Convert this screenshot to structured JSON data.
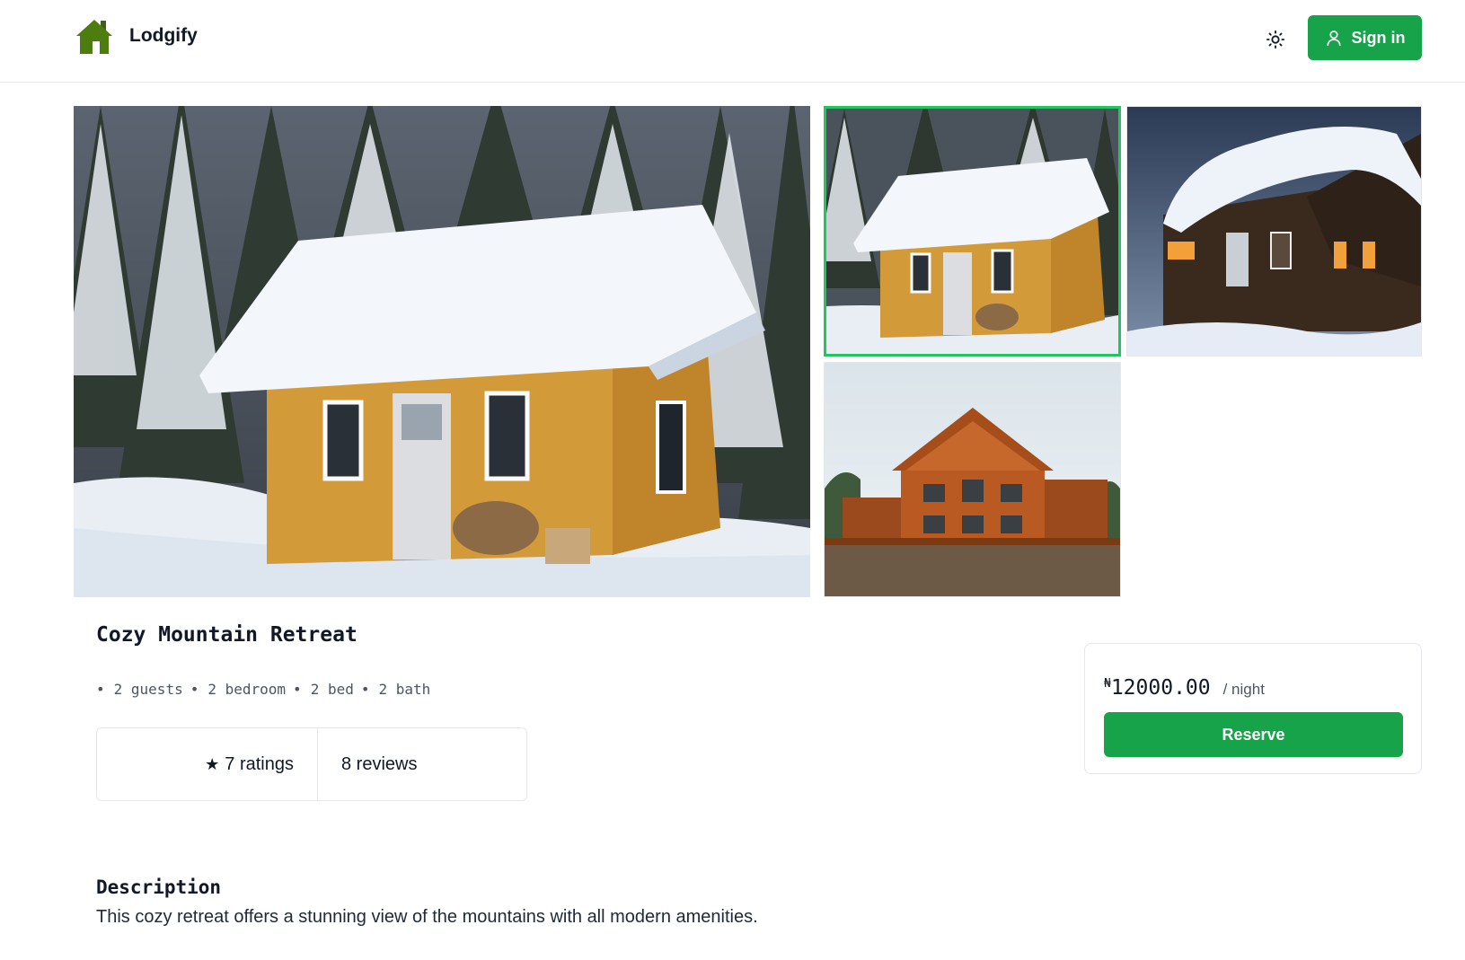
{
  "header": {
    "brand": "Lodgify",
    "signin_label": "Sign in",
    "brand_color": "#4d7c0f",
    "accent_color": "#16a34a"
  },
  "gallery": {
    "main_photo": "snow-cabin-photo",
    "thumbnails": [
      "snow-cabin-photo",
      "night-cabin-photo",
      "log-lodge-photo"
    ],
    "selected_thumbnail": 1
  },
  "listing": {
    "title": "Cozy Mountain Retreat",
    "specs": [
      "2 guests",
      "2 bedroom",
      "2 bed",
      "2 bath"
    ],
    "ratings_label": "7 ratings",
    "reviews_label": "8 reviews",
    "description_heading": "Description",
    "description_text": "This cozy retreat offers a stunning view of the mountains with all modern amenities."
  },
  "booking": {
    "currency_symbol": "₦",
    "price": "12000.00",
    "per_night": "/ night",
    "reserve_label": "Reserve"
  }
}
